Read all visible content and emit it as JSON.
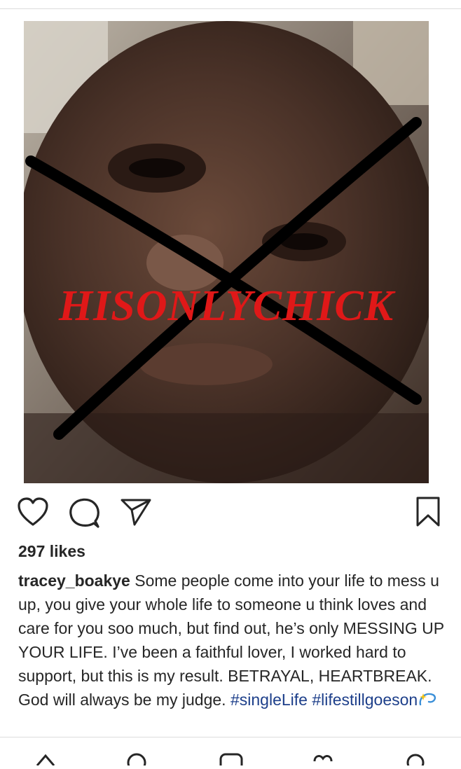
{
  "post": {
    "image": {
      "overlay_text": "HISONLYCHICK",
      "colors": {
        "overlay_text": "#e01818",
        "cross_lines": "#000000"
      }
    },
    "actions": {
      "like_icon": "heart-icon",
      "comment_icon": "comment-bubble-icon",
      "share_icon": "paper-plane-icon",
      "save_icon": "bookmark-icon"
    },
    "likes_text": "297 likes",
    "caption": {
      "username": "tracey_boakye",
      "text": "Some people come into your life to mess u up, you give your whole life to someone u think loves and care for you soo much, but find out, he’s only MESSING UP YOUR LIFE. I’ve been a faithful lover, I worked hard to support, but this is my result. BETRAYAL, HEARTBREAK. God will always be my judge.",
      "hashtags": [
        "#singleLife",
        "#lifestillgoeson"
      ],
      "emoji_icon": "dizzy-sparkle-icon"
    }
  },
  "bottom_nav": {
    "items": [
      "home-icon",
      "search-icon",
      "new-post-icon",
      "activity-icon",
      "profile-icon"
    ]
  },
  "colors": {
    "hashtag": "#1d3f8a",
    "text": "#262626",
    "divider": "#dcdcdc"
  }
}
